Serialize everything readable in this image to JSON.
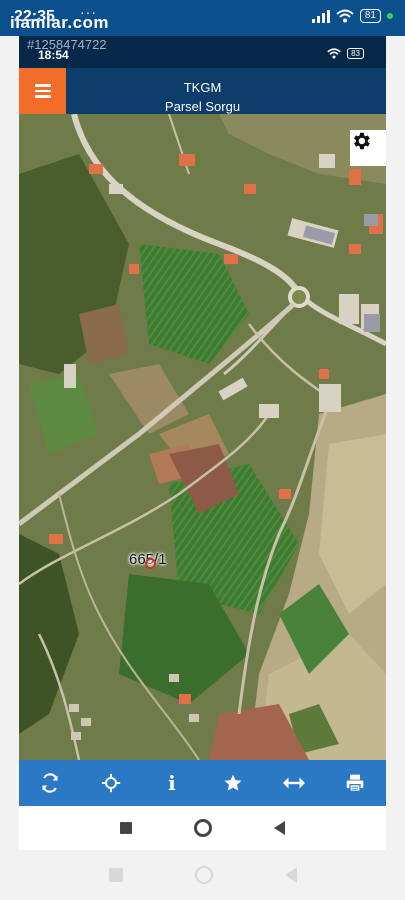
{
  "status_bar": {
    "time": "22:35",
    "notification_glyph": "✈",
    "more_indicator": "···",
    "battery": "81",
    "icons": [
      "signal-icon",
      "wifi-icon",
      "battery-icon",
      "dot-icon"
    ]
  },
  "watermark": {
    "text": "ilamlar.com"
  },
  "inner_status_bar": {
    "listing_id": "#1258474722",
    "time": "18:54",
    "battery": "83"
  },
  "header": {
    "title": "TKGM",
    "subtitle": "Parsel Sorgu",
    "menu_icon": "menu-icon",
    "accent_color": "#f26c2a",
    "background_color": "#0b3c6a"
  },
  "map": {
    "parcel_label": "665/1",
    "settings_icon": "gear-icon"
  },
  "toolbar": {
    "background_color": "#2b78c5",
    "tools": [
      {
        "name": "refresh",
        "icon": "refresh-icon"
      },
      {
        "name": "locate",
        "icon": "crosshair-icon"
      },
      {
        "name": "info",
        "icon": "info-icon",
        "glyph": "i"
      },
      {
        "name": "favorite",
        "icon": "star-icon"
      },
      {
        "name": "measure",
        "icon": "arrows-horizontal-icon"
      },
      {
        "name": "print",
        "icon": "printer-icon"
      }
    ]
  },
  "navigation": {
    "buttons": [
      "recent-apps-icon",
      "home-icon",
      "back-icon"
    ]
  }
}
